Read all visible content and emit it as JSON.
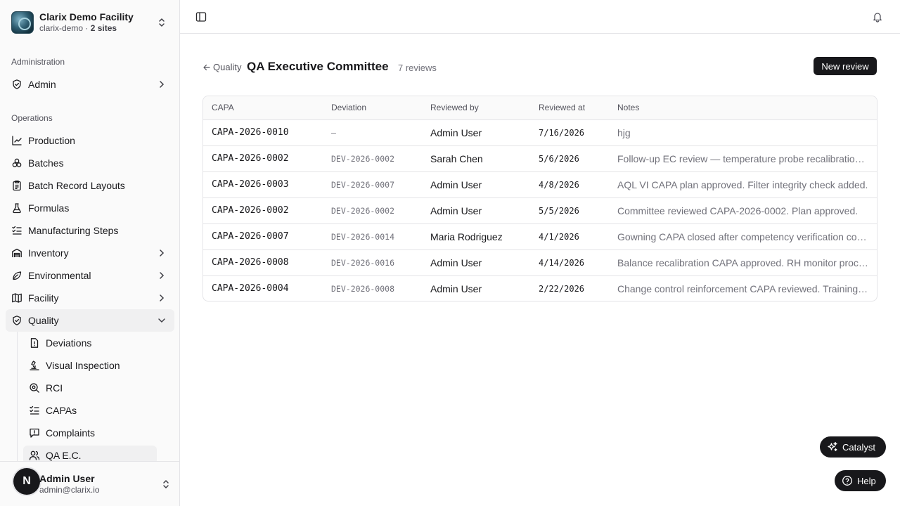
{
  "org": {
    "name": "Clarix Demo Facility",
    "slug": "clarix-demo",
    "sites": "2 sites"
  },
  "sidebar": {
    "admin_label": "Administration",
    "admin_item": "Admin",
    "ops_label": "Operations",
    "items": [
      {
        "label": "Production",
        "icon": "chart-icon"
      },
      {
        "label": "Batches",
        "icon": "batches-icon"
      },
      {
        "label": "Batch Record Layouts",
        "icon": "clipboard-icon"
      },
      {
        "label": "Formulas",
        "icon": "flask-icon"
      },
      {
        "label": "Manufacturing Steps",
        "icon": "list-check-icon"
      },
      {
        "label": "Inventory",
        "icon": "warehouse-icon"
      },
      {
        "label": "Environmental",
        "icon": "leaf-icon"
      },
      {
        "label": "Facility",
        "icon": "map-icon"
      },
      {
        "label": "Quality",
        "icon": "shield-icon"
      }
    ],
    "quality_sub": [
      {
        "label": "Deviations",
        "icon": "file-alert-icon"
      },
      {
        "label": "Visual Inspection",
        "icon": "microscope-icon"
      },
      {
        "label": "RCI",
        "icon": "search-icon"
      },
      {
        "label": "CAPAs",
        "icon": "list-check-icon"
      },
      {
        "label": "Complaints",
        "icon": "message-alert-icon"
      },
      {
        "label": "QA E.C.",
        "icon": "users-icon"
      }
    ]
  },
  "user": {
    "initial": "N",
    "name": "Admin User",
    "email": "admin@clarix.io"
  },
  "header": {
    "back_label": "Quality",
    "title": "QA Executive Committee",
    "count": "7 reviews",
    "new_button": "New review"
  },
  "table": {
    "columns": [
      "CAPA",
      "Deviation",
      "Reviewed by",
      "Reviewed at",
      "Notes"
    ],
    "rows": [
      {
        "capa": "CAPA-2026-0010",
        "deviation": "—",
        "reviewed_by": "Admin User",
        "reviewed_at": "7/16/2026",
        "notes": "hjg"
      },
      {
        "capa": "CAPA-2026-0002",
        "deviation": "DEV-2026-0002",
        "reviewed_by": "Sarah Chen",
        "reviewed_at": "5/6/2026",
        "notes": "Follow-up EC review — temperature probe recalibration verified."
      },
      {
        "capa": "CAPA-2026-0003",
        "deviation": "DEV-2026-0007",
        "reviewed_by": "Admin User",
        "reviewed_at": "4/8/2026",
        "notes": "AQL VI CAPA plan approved. Filter integrity check added."
      },
      {
        "capa": "CAPA-2026-0002",
        "deviation": "DEV-2026-0002",
        "reviewed_by": "Admin User",
        "reviewed_at": "5/5/2026",
        "notes": "Committee reviewed CAPA-2026-0002. Plan approved."
      },
      {
        "capa": "CAPA-2026-0007",
        "deviation": "DEV-2026-0014",
        "reviewed_by": "Maria Rodriguez",
        "reviewed_at": "4/1/2026",
        "notes": "Gowning CAPA closed after competency verification completed."
      },
      {
        "capa": "CAPA-2026-0008",
        "deviation": "DEV-2026-0016",
        "reviewed_by": "Admin User",
        "reviewed_at": "4/14/2026",
        "notes": "Balance recalibration CAPA approved. RH monitor procured."
      },
      {
        "capa": "CAPA-2026-0004",
        "deviation": "DEV-2026-0008",
        "reviewed_by": "Admin User",
        "reviewed_at": "2/22/2026",
        "notes": "Change control reinforcement CAPA reviewed. Training scheduled."
      }
    ]
  },
  "fabs": {
    "catalyst": "Catalyst",
    "help": "Help"
  }
}
